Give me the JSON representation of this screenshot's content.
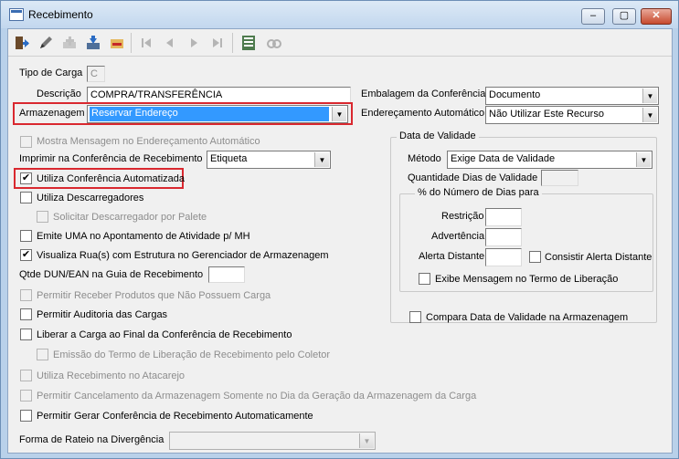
{
  "window": {
    "title": "Recebimento",
    "minimize": "–",
    "maximize": "▢",
    "close": "✕"
  },
  "toolbar": {
    "icons": [
      "exit-icon",
      "edit-icon",
      "add-icon",
      "save-icon",
      "cancel-icon",
      "first-icon",
      "prev-icon",
      "next-icon",
      "last-icon",
      "list-icon",
      "search-icon"
    ]
  },
  "form": {
    "tipo_carga": {
      "label": "Tipo de Carga",
      "value": "C"
    },
    "descricao": {
      "label": "Descrição",
      "value": "COMPRA/TRANSFERÊNCIA"
    },
    "armazenagem": {
      "label": "Armazenagem",
      "value": "Reservar Endereço"
    },
    "embalagem": {
      "label": "Embalagem da Conferência",
      "value": "Documento"
    },
    "enderecamento": {
      "label": "Endereçamento Automático",
      "value": "Não Utilizar Este Recurso"
    },
    "mostra_msg": {
      "label": "Mostra Mensagem no Endereçamento Automático",
      "checked": false
    },
    "imprimir": {
      "label": "Imprimir na Conferência de Recebimento",
      "value": "Etiqueta"
    },
    "utiliza_conf": {
      "label": "Utiliza Conferência Automatizada",
      "checked": true,
      "mark": "✔"
    },
    "utiliza_desc": {
      "label": "Utiliza Descarregadores",
      "checked": false
    },
    "solicitar_desc": {
      "label": "Solicitar Descarregador por Palete",
      "checked": false
    },
    "emite_uma": {
      "label": "Emite UMA no Apontamento de Atividade p/ MH",
      "checked": false
    },
    "visualiza_rua": {
      "label": "Visualiza Rua(s) com Estrutura no Gerenciador de Armazenagem",
      "checked": true,
      "mark": "✔"
    },
    "qtde_dun": {
      "label": "Qtde DUN/EAN na Guia de Recebimento",
      "value": ""
    },
    "permitir_receber": {
      "label": "Permitir Receber Produtos que Não Possuem Carga",
      "checked": false
    },
    "permitir_auditoria": {
      "label": "Permitir Auditoria das Cargas",
      "checked": false
    },
    "liberar_carga": {
      "label": "Liberar a Carga ao Final da Conferência de Recebimento",
      "checked": false
    },
    "emissao_termo": {
      "label": "Emissão do Termo de Liberação de Recebimento pelo Coletor",
      "checked": false
    },
    "utiliza_atacarejo": {
      "label": "Utiliza Recebimento no Atacarejo",
      "checked": false
    },
    "permitir_cancel": {
      "label": "Permitir Cancelamento da Armazenagem Somente no Dia da Geração da Armazenagem da Carga",
      "checked": false
    },
    "permitir_gerar": {
      "label": "Permitir Gerar Conferência de Recebimento Automaticamente",
      "checked": false
    },
    "forma_rateio": {
      "label": "Forma de Rateio na Divergência",
      "value": ""
    }
  },
  "validade": {
    "group_title": "Data de Validade",
    "metodo": {
      "label": "Método",
      "value": "Exige Data de Validade"
    },
    "quantidade": {
      "label": "Quantidade Dias de Validade",
      "value": ""
    },
    "pct_group_title": "% do Número de Dias para",
    "restricao": {
      "label": "Restrição",
      "value": ""
    },
    "advertencia": {
      "label": "Advertência",
      "value": ""
    },
    "alerta": {
      "label": "Alerta Distante",
      "value": ""
    },
    "consistir": {
      "label": "Consistir Alerta Distante",
      "checked": false
    },
    "exibe_msg": {
      "label": "Exibe Mensagem no Termo de Liberação",
      "checked": false
    },
    "compara": {
      "label": "Compara Data de Validade na Armazenagem",
      "checked": false
    }
  },
  "colors": {
    "highlight": "#d9282f",
    "selection": "#3399ff",
    "frame": "#b9d1ea"
  }
}
